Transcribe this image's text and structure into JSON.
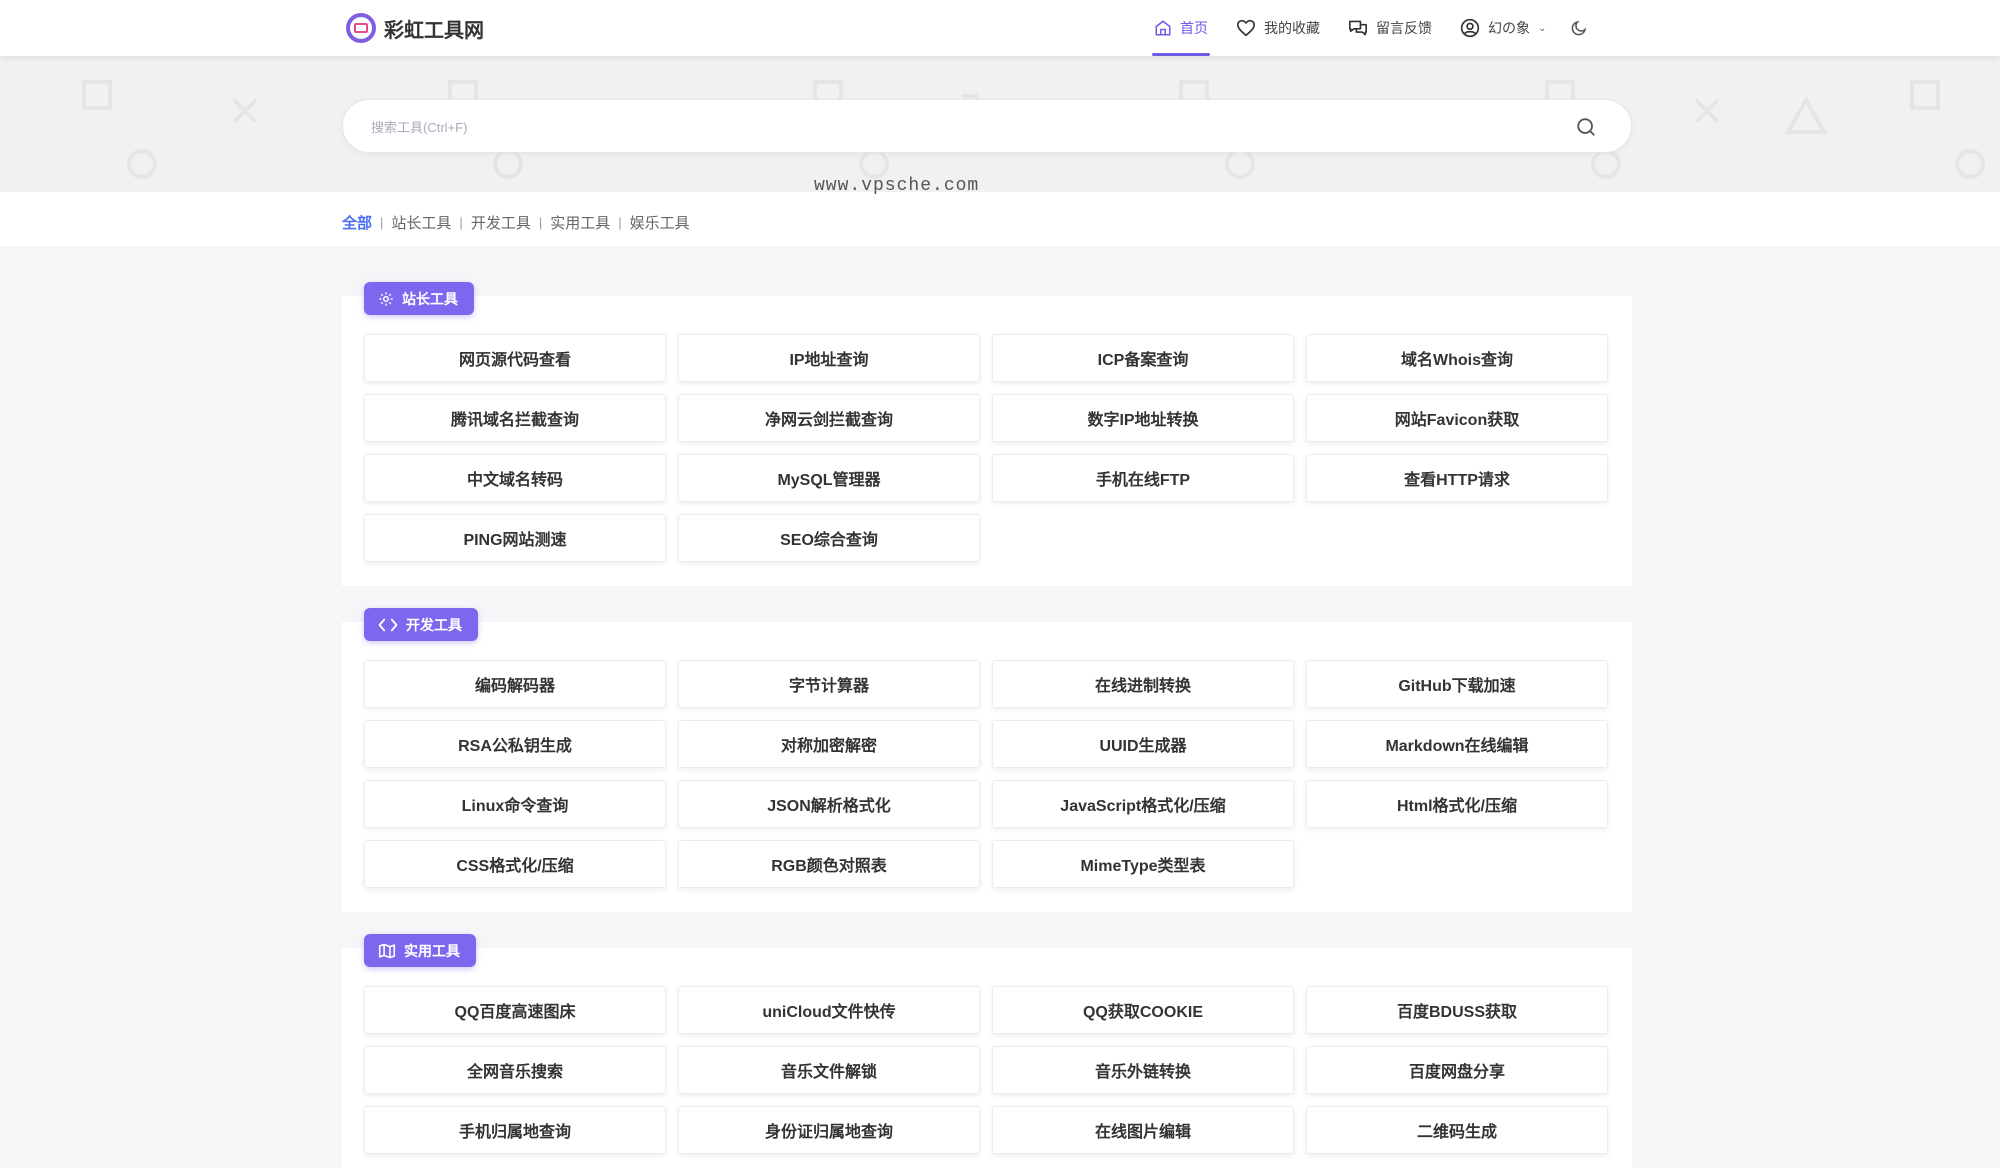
{
  "brand": {
    "name": "彩虹工具网"
  },
  "nav": [
    {
      "label": "首页",
      "icon": "home-icon",
      "active": true
    },
    {
      "label": "我的收藏",
      "icon": "heart-icon",
      "active": false
    },
    {
      "label": "留言反馈",
      "icon": "chat-icon",
      "active": false
    },
    {
      "label": "幻の象",
      "icon": "user-icon",
      "active": false
    }
  ],
  "search": {
    "placeholder": "搜索工具(Ctrl+F)"
  },
  "watermark": "www.vpsche.com",
  "filters": [
    {
      "label": "全部",
      "active": true
    },
    {
      "label": "站长工具",
      "active": false
    },
    {
      "label": "开发工具",
      "active": false
    },
    {
      "label": "实用工具",
      "active": false
    },
    {
      "label": "娱乐工具",
      "active": false
    }
  ],
  "sections": [
    {
      "title": "站长工具",
      "icon": "gear-icon",
      "tools": [
        "网页源代码查看",
        "IP地址查询",
        "ICP备案查询",
        "域名Whois查询",
        "腾讯域名拦截查询",
        "净网云剑拦截查询",
        "数字IP地址转换",
        "网站Favicon获取",
        "中文域名转码",
        "MySQL管理器",
        "手机在线FTP",
        "查看HTTP请求",
        "PING网站测速",
        "SEO综合查询"
      ]
    },
    {
      "title": "开发工具",
      "icon": "code-icon",
      "tools": [
        "编码解码器",
        "字节计算器",
        "在线进制转换",
        "GitHub下载加速",
        "RSA公私钥生成",
        "对称加密解密",
        "UUID生成器",
        "Markdown在线编辑",
        "Linux命令查询",
        "JSON解析格式化",
        "JavaScript格式化/压缩",
        "Html格式化/压缩",
        "CSS格式化/压缩",
        "RGB颜色对照表",
        "MimeType类型表"
      ]
    },
    {
      "title": "实用工具",
      "icon": "map-icon",
      "tools": [
        "QQ百度高速图床",
        "uniCloud文件快传",
        "QQ获取COOKIE",
        "百度BDUSS获取",
        "全网音乐搜索",
        "音乐文件解锁",
        "音乐外链转换",
        "百度网盘分享",
        "手机归属地查询",
        "身份证归属地查询",
        "在线图片编辑",
        "二维码生成"
      ]
    }
  ],
  "colors": {
    "accent": "#7b68ee",
    "nav_active": "#6c5ce7",
    "filter_active": "#4a6cf7"
  }
}
